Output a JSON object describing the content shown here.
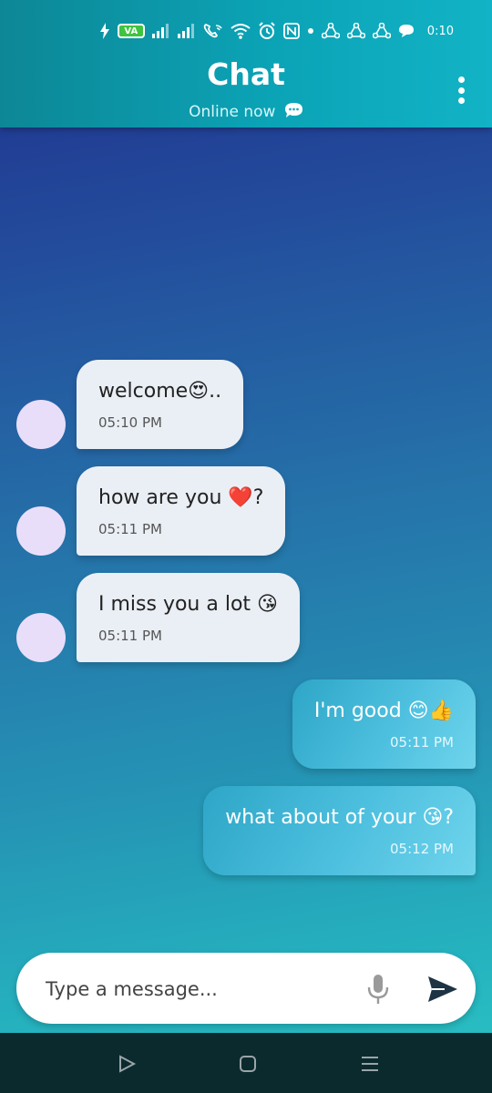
{
  "status_bar": {
    "battery_label": "VA",
    "time": "0:10"
  },
  "header": {
    "title": "Chat",
    "subtitle": "Online now",
    "menu_icon": "more-vertical-icon"
  },
  "messages": [
    {
      "direction": "in",
      "text": "welcome😍..",
      "time": "05:10 PM"
    },
    {
      "direction": "in",
      "text": "how are you ❤️?",
      "time": "05:11 PM"
    },
    {
      "direction": "in",
      "text": "I miss you a lot 😘",
      "time": "05:11 PM"
    },
    {
      "direction": "out",
      "text": "I'm good 😊👍",
      "time": "05:11 PM"
    },
    {
      "direction": "out",
      "text": "what about of your 😘?",
      "time": "05:12 PM"
    }
  ],
  "composer": {
    "placeholder": "Type a message...",
    "mic_icon": "microphone-icon",
    "send_icon": "send-icon"
  },
  "navigation": {
    "back_icon": "back-triangle-icon",
    "home_icon": "home-square-icon",
    "recents_icon": "recents-menu-icon"
  },
  "colors": {
    "header": "#0ba3b6",
    "incoming_bubble": "#eaeff5",
    "outgoing_bubble": "#4ec0df",
    "avatar": "#e9defa",
    "nav_bar": "#0b2a2e"
  }
}
